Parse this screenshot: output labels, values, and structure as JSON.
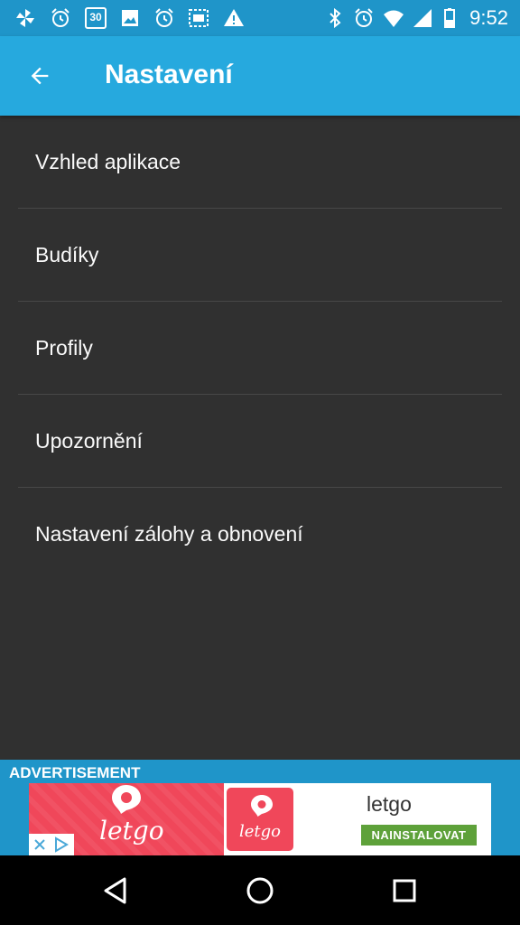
{
  "status_bar": {
    "time": "9:52",
    "left_icons": [
      "pinwheel-icon",
      "alarm-clock-icon",
      "calendar-icon",
      "image-icon",
      "alarm-clock-icon",
      "clock-widget-icon",
      "warning-icon"
    ],
    "right_icons": [
      "bluetooth-icon",
      "alarm-clock-icon",
      "wifi-icon",
      "cell-signal-icon",
      "battery-icon"
    ],
    "calendar_day": "30"
  },
  "app_bar": {
    "title": "Nastavení",
    "back_icon": "arrow-back-icon",
    "background": "#26a9de"
  },
  "settings": {
    "items": [
      {
        "label": "Vzhled aplikace"
      },
      {
        "label": "Budíky"
      },
      {
        "label": "Profily"
      },
      {
        "label": "Upozornění"
      },
      {
        "label": "Nastavení zálohy a obnovení"
      }
    ]
  },
  "ad": {
    "label": "ADVERTISEMENT",
    "brand_logo": "letgo",
    "app_name": "letgo",
    "install_button": "NAINSTALOVAT",
    "brand_color": "#f0475a",
    "install_color": "#5ea13a"
  },
  "nav_bar": {
    "icons": [
      "back-triangle-icon",
      "home-circle-icon",
      "recents-square-icon"
    ]
  }
}
